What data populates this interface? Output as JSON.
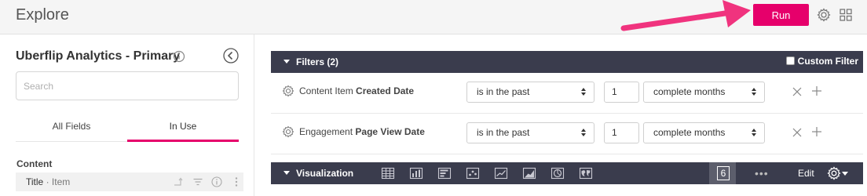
{
  "header": {
    "title": "Explore",
    "run_label": "Run",
    "settings_icon": "gear-icon",
    "apps_icon": "grid-icon"
  },
  "sidebar": {
    "model_name": "Uberflip Analytics - Primary",
    "search_placeholder": "Search",
    "tabs": [
      {
        "label": "All Fields",
        "active": false
      },
      {
        "label": "In Use",
        "active": true
      }
    ],
    "sections": [
      {
        "label": "Content",
        "fields": [
          {
            "view": "Title",
            "separator": " · ",
            "name": "Item"
          }
        ]
      }
    ]
  },
  "filters": {
    "title": "Filters (2)",
    "custom_filter_label": "Custom Filter",
    "rows": [
      {
        "field_view": "Content Item",
        "field_name": "Created Date",
        "operator": "is in the past",
        "value": "1",
        "unit": "complete months"
      },
      {
        "field_view": "Engagement",
        "field_name": "Page View Date",
        "operator": "is in the past",
        "value": "1",
        "unit": "complete months"
      }
    ]
  },
  "visualization": {
    "title": "Visualization",
    "edit_label": "Edit",
    "types": [
      "table-icon",
      "column-chart-icon",
      "bar-chart-icon",
      "scatter-icon",
      "line-chart-icon",
      "area-chart-icon",
      "pie-chart-icon",
      "map-icon",
      "single-value-icon"
    ],
    "single_value_glyph": "6",
    "more_glyph": "•••"
  },
  "colors": {
    "accent": "#e6006b",
    "bar_bg": "#3a3c4d"
  }
}
